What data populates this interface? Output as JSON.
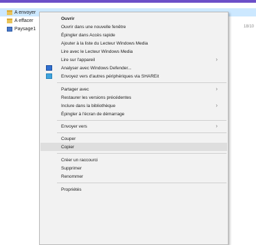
{
  "explorer": {
    "files": [
      {
        "name": "A envoyer",
        "type": "folder",
        "selected": true
      },
      {
        "name": "A effacer",
        "type": "folder",
        "selected": false
      },
      {
        "name": "Paysage1",
        "type": "image",
        "selected": false
      }
    ],
    "date_partial": "18/10"
  },
  "menu": {
    "items": [
      {
        "label": "Ouvrir",
        "bold": true
      },
      {
        "label": "Ouvrir dans une nouvelle fenêtre"
      },
      {
        "label": "Épingler dans Accès rapide"
      },
      {
        "label": "Ajouter à la liste du Lecteur Windows Media"
      },
      {
        "label": "Lire avec le Lecteur Windows Media"
      },
      {
        "label": "Lire sur l'appareil",
        "submenu": true
      },
      {
        "label": "Analyser avec Windows Defender...",
        "icon": "windows-defender-icon"
      },
      {
        "label": "Envoyez vers d'autres périphériques via SHAREit",
        "icon": "shareit-icon"
      },
      {
        "label": "Partager avec",
        "submenu": true
      },
      {
        "label": "Restaurer les versions précédentes"
      },
      {
        "label": "Inclure dans la bibliothèque",
        "submenu": true
      },
      {
        "label": "Épingler à l'écran de démarrage"
      },
      {
        "label": "Envoyer vers",
        "submenu": true
      },
      {
        "label": "Couper"
      },
      {
        "label": "Copier",
        "highlighted": true
      },
      {
        "label": "Créer un raccourci"
      },
      {
        "label": "Supprimer"
      },
      {
        "label": "Renommer"
      },
      {
        "label": "Propriétés"
      }
    ],
    "submenu_arrow": "›"
  },
  "colors": {
    "accent_bar": "#6b4fc8",
    "selection": "#cce8ff",
    "menu_bg": "#f2f2f2",
    "hover": "#dedede"
  }
}
